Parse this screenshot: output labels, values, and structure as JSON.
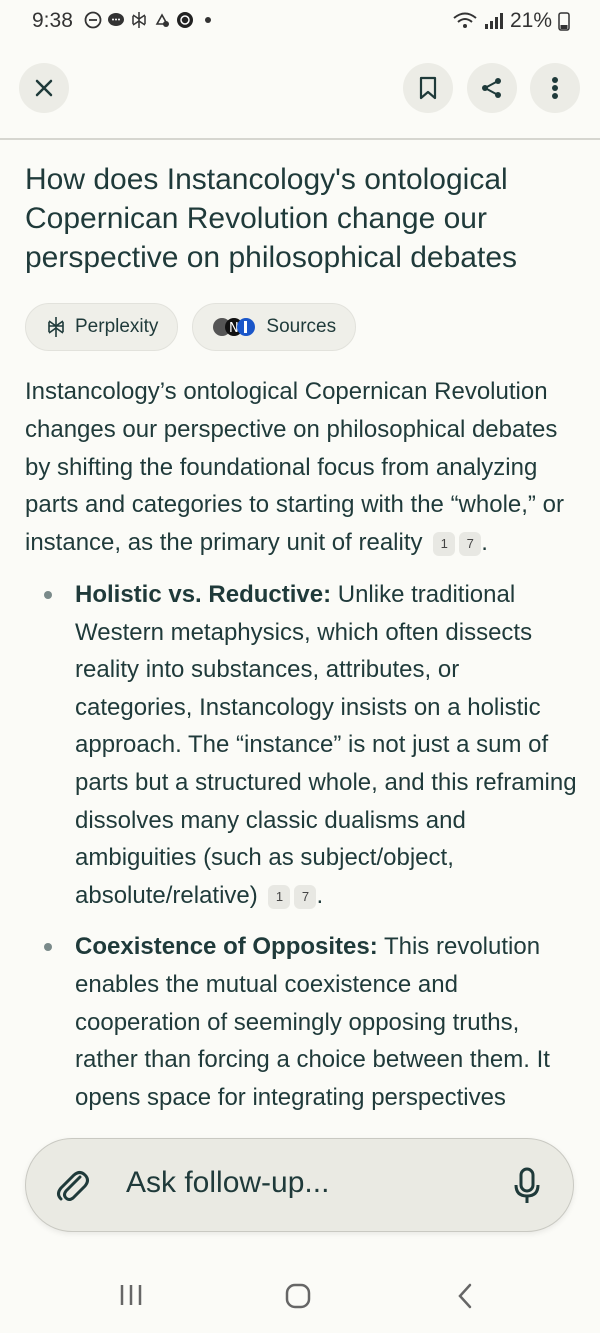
{
  "status_bar": {
    "time": "9:38",
    "battery": "21%"
  },
  "header": {
    "close_icon": "close-icon",
    "bookmark_icon": "bookmark-icon",
    "share_icon": "share-icon",
    "more_icon": "more-vertical-icon"
  },
  "question": {
    "title": "How does Instancology's ontological Copernican Revolution change our perspective on philosophical debates"
  },
  "chips": {
    "perplexity_label": "Perplexity",
    "sources_label": "Sources"
  },
  "answer": {
    "intro": "Instancology’s ontological Copernican Revolution changes our perspective on philosophical debates by shifting the foundational focus from analyzing parts and categories to starting with the “whole,” or instance, as the primary unit of reality",
    "intro_citations": [
      "1",
      "7"
    ],
    "bullets": [
      {
        "heading": "Holistic vs. Reductive:",
        "text": " Unlike traditional Western metaphysics, which often dissects reality into substances, attributes, or categories, Instancology insists on a holistic approach. The “instance” is not just a sum of parts but a structured whole, and this reframing dissolves many classic dualisms and ambiguities (such as subject/object, absolute/relative)",
        "citations": [
          "1",
          "7"
        ]
      },
      {
        "heading": "Coexistence of Opposites:",
        "text": " This revolution enables the mutual coexistence and cooperation of seemingly opposing truths, rather than forcing a choice between them. It opens space for integrating perspectives"
      }
    ]
  },
  "followup": {
    "placeholder": "Ask follow-up..."
  },
  "colors": {
    "background": "#fbfbf7",
    "text": "#1f3a3a",
    "chip_bg": "#efefe9"
  }
}
